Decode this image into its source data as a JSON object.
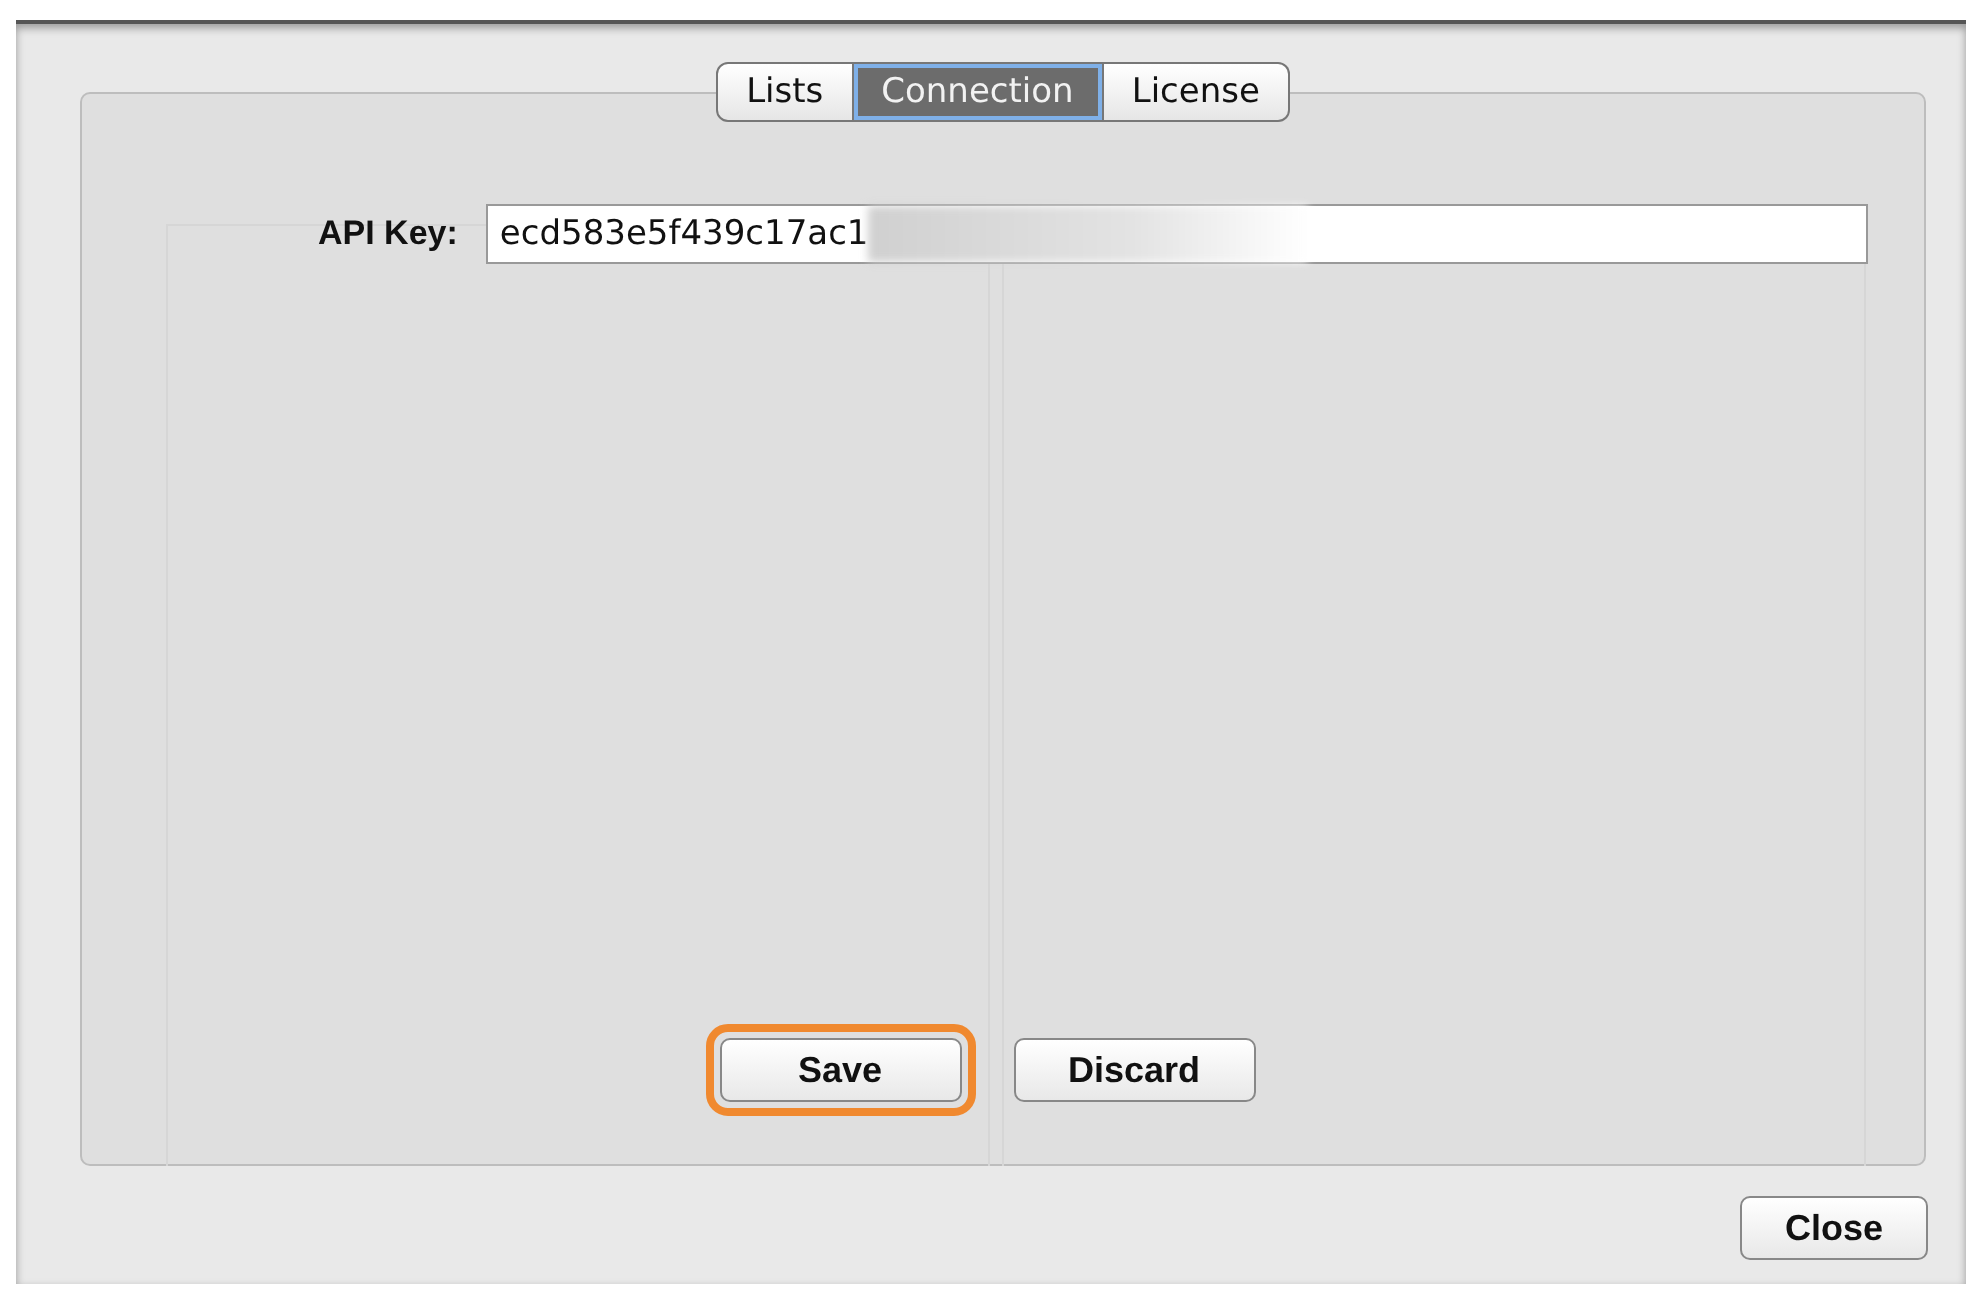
{
  "tabs": [
    {
      "label": "Lists",
      "selected": false
    },
    {
      "label": "Connection",
      "selected": true
    },
    {
      "label": "License",
      "selected": false
    }
  ],
  "api_key": {
    "label": "API Key:",
    "value": "ecd583e5f439c17ac1",
    "redacted": true
  },
  "buttons": [
    {
      "label": "Save",
      "highlighted": true
    },
    {
      "label": "Discard",
      "highlighted": false
    }
  ],
  "close_button": {
    "label": "Close"
  }
}
